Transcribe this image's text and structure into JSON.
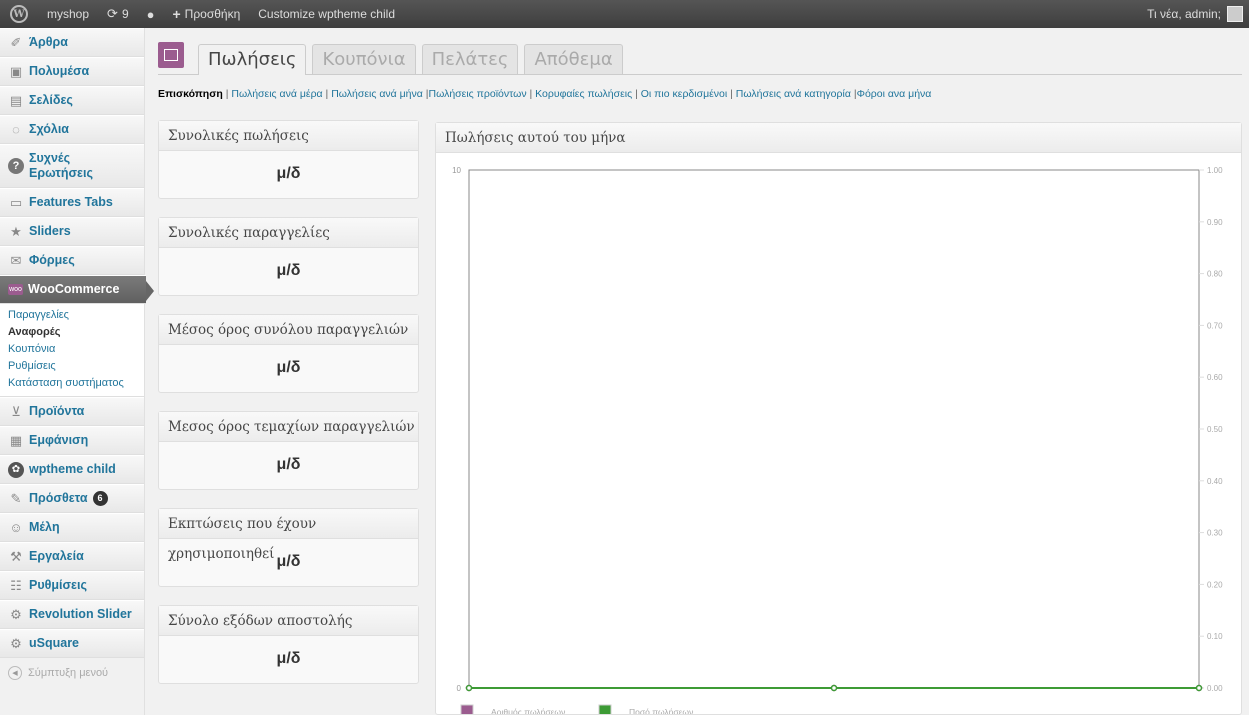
{
  "adminbar": {
    "site": "myshop",
    "updates": "9",
    "new_label": "Προσθήκη",
    "customize": "Customize wptheme child",
    "greeting": "Τι νέα, admin;"
  },
  "sidebar": {
    "items": [
      {
        "label": "Άρθρα",
        "icon": "pin-icon"
      },
      {
        "label": "Πολυμέσα",
        "icon": "media-icon"
      },
      {
        "label": "Σελίδες",
        "icon": "pages-icon"
      },
      {
        "label": "Σχόλια",
        "icon": "comments-icon"
      },
      {
        "label": "Συχνές Ερωτήσεις",
        "icon": "question-icon"
      },
      {
        "label": "Features Tabs",
        "icon": "tabs-icon"
      },
      {
        "label": "Sliders",
        "icon": "star-icon"
      },
      {
        "label": "Φόρμες",
        "icon": "mail-icon"
      },
      {
        "label": "WooCommerce",
        "icon": "woo-icon"
      }
    ],
    "woo_icon_text": "woo",
    "submenu": [
      "Παραγγελίες",
      "Αναφορές",
      "Κουπόνια",
      "Ρυθμίσεις",
      "Κατάσταση συστήματος"
    ],
    "items2": [
      {
        "label": "Προϊόντα",
        "icon": "cart-icon"
      },
      {
        "label": "Εμφάνιση",
        "icon": "appearance-icon"
      },
      {
        "label": "wptheme child",
        "icon": "theme-icon"
      },
      {
        "label": "Πρόσθετα",
        "icon": "plugin-icon"
      },
      {
        "label": "Μέλη",
        "icon": "users-icon"
      },
      {
        "label": "Εργαλεία",
        "icon": "tools-icon"
      },
      {
        "label": "Ρυθμίσεις",
        "icon": "settings-icon"
      },
      {
        "label": "Revolution Slider",
        "icon": "gear-icon"
      },
      {
        "label": "uSquare",
        "icon": "gear-icon"
      }
    ],
    "plugins_badge": "6",
    "collapse": "Σύμπτυξη μενού"
  },
  "tabs": [
    "Πωλήσεις",
    "Κουπόνια",
    "Πελάτες",
    "Απόθεμα"
  ],
  "subnav": {
    "current": "Επισκόπηση",
    "links": [
      "Πωλήσεις ανά μέρα",
      "Πωλήσεις ανά μήνα",
      "Πωλήσεις προϊόντων",
      "Κορυφαίες πωλήσεις",
      "Οι πιο κερδισμένοι",
      "Πωλήσεις ανά κατηγορία",
      "Φόροι ανα μήνα"
    ]
  },
  "stats": [
    {
      "title": "Συνολικές πωλήσεις",
      "value": "μ/δ"
    },
    {
      "title": "Συνολικές παραγγελίες",
      "value": "μ/δ"
    },
    {
      "title": "Μέσος όρος συνόλου παραγγελιών",
      "value": "μ/δ"
    },
    {
      "title": "Μεσος όρος τεμαχίων παραγγελιών",
      "value": "μ/δ"
    },
    {
      "title": "Εκπτώσεις που έχουν χρησιμοποιηθεί",
      "value": "μ/δ"
    },
    {
      "title": "Σύνολο εξόδων αποστολής",
      "value": "μ/δ"
    }
  ],
  "chart_title": "Πωλήσεις αυτού του μήνα",
  "chart_data": {
    "type": "line",
    "title": "Πωλήσεις αυτού του μήνα",
    "left_axis": {
      "ylim": [
        0,
        10
      ],
      "ticks": [
        "0",
        "10"
      ]
    },
    "right_axis": {
      "ylim": [
        0,
        1
      ],
      "ticks": [
        "0.00",
        "0.10",
        "0.20",
        "0.30",
        "0.40",
        "0.50",
        "0.60",
        "0.70",
        "0.80",
        "0.90",
        "1.00"
      ]
    },
    "series": [
      {
        "name": "Αριθμός πωλήσεων",
        "color": "#9b5c8f",
        "values": [
          0,
          0,
          0
        ]
      },
      {
        "name": "Ποσό πωλήσεων",
        "color": "#3d9b35",
        "values": [
          0,
          0,
          0
        ]
      }
    ],
    "legend": "bottom-left",
    "grid": false
  }
}
